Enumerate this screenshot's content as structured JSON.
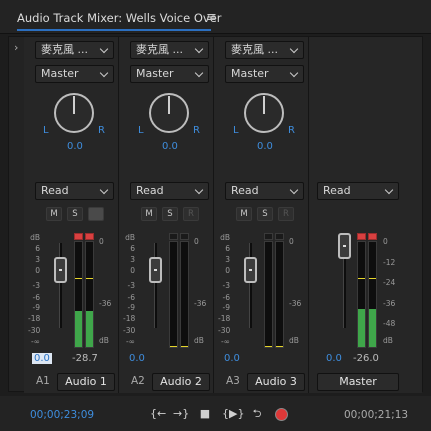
{
  "header": {
    "title": "Audio Track Mixer: Wells Voice Over",
    "menu_icon": "hamburger-menu-icon"
  },
  "expand_icon": "chevron-right-icon",
  "channels": [
    {
      "input": "麥克風 ...",
      "output": "Master",
      "pan_left": "L",
      "pan_right": "R",
      "pan_value": "0.0",
      "automation": "Read",
      "m": "M",
      "s": "S",
      "r": "R",
      "volume": "0.0",
      "peak": "-28.7",
      "track_id": "A1",
      "name": "Audio 1"
    },
    {
      "input": "麥克風 ...",
      "output": "Master",
      "pan_left": "L",
      "pan_right": "R",
      "pan_value": "0.0",
      "automation": "Read",
      "m": "M",
      "s": "S",
      "r": "R",
      "volume": "0.0",
      "peak": "",
      "track_id": "A2",
      "name": "Audio 2"
    },
    {
      "input": "麥克風 ...",
      "output": "Master",
      "pan_left": "L",
      "pan_right": "R",
      "pan_value": "0.0",
      "automation": "Read",
      "m": "M",
      "s": "S",
      "r": "R",
      "volume": "0.0",
      "peak": "",
      "track_id": "A3",
      "name": "Audio 3"
    }
  ],
  "master": {
    "automation": "Read",
    "volume": "0.0",
    "peak": "-26.0",
    "name": "Master"
  },
  "fader_scale": [
    "dB",
    "6",
    "3",
    "0",
    "-3",
    "-6",
    "-9",
    "-18",
    "-30",
    "-∞"
  ],
  "track_meter_scale": [
    "0",
    "-36",
    "dB"
  ],
  "master_meter_scale": [
    "0",
    "-12",
    "-24",
    "-36",
    "-48",
    "dB"
  ],
  "footer": {
    "timecode_left": "00;00;23;09",
    "timecode_right": "00;00;21;13"
  },
  "transport": [
    {
      "name": "go-to-in-icon",
      "glyph": "{←"
    },
    {
      "name": "go-to-out-icon",
      "glyph": "→}"
    },
    {
      "name": "stop-icon",
      "glyph": "■"
    },
    {
      "name": "play-in-to-out-icon",
      "glyph": "{▶}"
    },
    {
      "name": "loop-icon",
      "glyph": "⮌"
    },
    {
      "name": "record-icon",
      "glyph": ""
    }
  ],
  "colors": {
    "accent": "#3e8ddd",
    "meter_green": "#3fa64a",
    "clip_red": "#d94040",
    "record_red": "#dd3838"
  }
}
